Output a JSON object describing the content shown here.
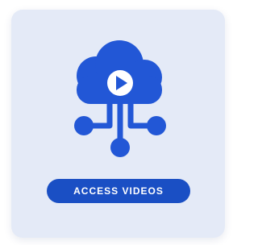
{
  "card": {
    "icon": "cloud-video-network-icon",
    "button_label": "ACCESS VIDEOS"
  },
  "colors": {
    "card_background": "#e4eaf7",
    "accent": "#1a4fc4",
    "icon_fill": "#2257d6"
  }
}
